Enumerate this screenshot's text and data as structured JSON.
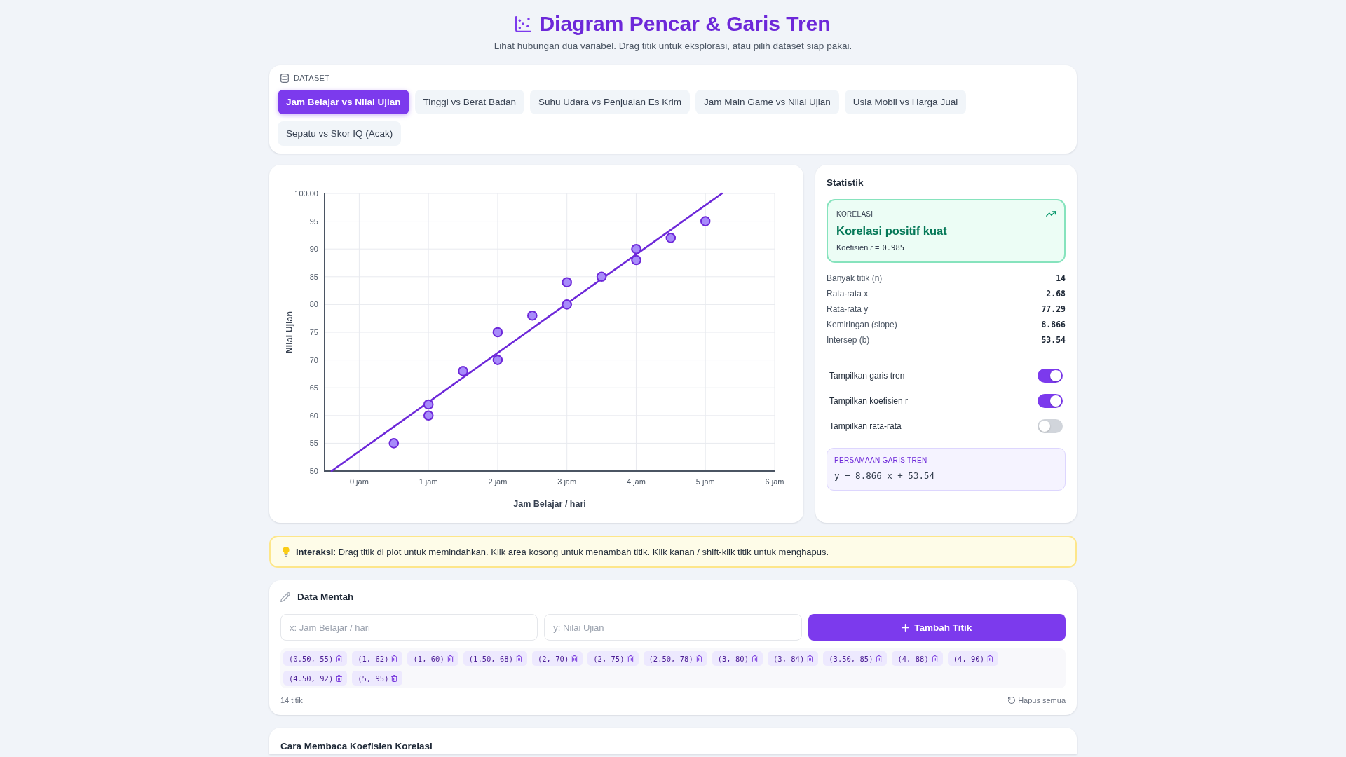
{
  "header": {
    "title": "Diagram Pencar & Garis Tren",
    "subtitle": "Lihat hubungan dua variabel. Drag titik untuk eksplorasi, atau pilih dataset siap pakai."
  },
  "dataset": {
    "label": "DATASET",
    "options": [
      {
        "label": "Jam Belajar vs Nilai Ujian",
        "selected": true
      },
      {
        "label": "Tinggi vs Berat Badan",
        "selected": false
      },
      {
        "label": "Suhu Udara vs Penjualan Es Krim",
        "selected": false
      },
      {
        "label": "Jam Main Game vs Nilai Ujian",
        "selected": false
      },
      {
        "label": "Usia Mobil vs Harga Jual",
        "selected": false
      },
      {
        "label": "Sepatu vs Skor IQ (Acak)",
        "selected": false
      }
    ]
  },
  "chart": {
    "chart_data": {
      "type": "scatter",
      "xlabel": "Jam Belajar / hari",
      "ylabel": "Nilai Ujian",
      "x": [
        0.5,
        1,
        1,
        1.5,
        2,
        2,
        2.5,
        3,
        3,
        3.5,
        4,
        4,
        4.5,
        5
      ],
      "series": [
        {
          "color": "#a78bfa",
          "values": [
            55,
            62,
            60,
            68,
            70,
            75,
            78,
            80,
            84,
            85,
            88,
            90,
            92,
            95
          ]
        },
        {
          "type": "line",
          "color": "#6d28d9",
          "x": [
            -0.4,
            5.24
          ],
          "values": [
            50,
            100
          ]
        }
      ],
      "xlim": [
        -0.5,
        6
      ],
      "ylim": [
        50,
        100
      ],
      "xticks": [
        {
          "value": 0,
          "label": "0 jam"
        },
        {
          "value": 1,
          "label": "1 jam"
        },
        {
          "value": 2,
          "label": "2 jam"
        },
        {
          "value": 3,
          "label": "3 jam"
        },
        {
          "value": 4,
          "label": "4 jam"
        },
        {
          "value": 5,
          "label": "5 jam"
        },
        {
          "value": 6,
          "label": "6 jam"
        }
      ],
      "yticks": [
        50,
        55,
        60,
        65,
        70,
        75,
        80,
        85,
        90,
        95,
        {
          "value": 100,
          "label": "100.00"
        }
      ],
      "grid": true
    }
  },
  "stats": {
    "title": "Statistik",
    "correlation": {
      "label": "KORELASI",
      "verdict": "Korelasi positif kuat",
      "coefficient_label": "Koefisien *r* =",
      "coefficient": "0.985"
    },
    "rows": [
      {
        "label": "Banyak titik (n)",
        "value": "14"
      },
      {
        "label": "Rata-rata x",
        "value": "2.68"
      },
      {
        "label": "Rata-rata y",
        "value": "77.29"
      },
      {
        "label": "Kemiringan (slope)",
        "value": "8.866"
      },
      {
        "label": "Intersep (b)",
        "value": "53.54"
      }
    ],
    "toggles": [
      {
        "label": "Tampilkan garis tren",
        "on": true
      },
      {
        "label": "Tampilkan koefisien r",
        "on": true
      },
      {
        "label": "Tampilkan rata-rata",
        "on": false
      }
    ],
    "equation": {
      "label": "PERSAMAAN GARIS TREN",
      "text": "y = 8.866 x + 53.54"
    }
  },
  "hint": {
    "text": "**Interaksi**: Drag titik di plot untuk memindahkan. Klik area kosong untuk menambah titik. Klik kanan / shift-klik titik untuk menghapus."
  },
  "raw_data": {
    "title": "Data Mentah",
    "x_field": {
      "placeholder": "x: Jam Belajar / hari"
    },
    "y_field": {
      "placeholder": "y: Nilai Ujian"
    },
    "add_button": "Tambah Titik",
    "points": [
      "(0.50, 55)",
      "(1, 62)",
      "(1, 60)",
      "(1.50, 68)",
      "(2, 70)",
      "(2, 75)",
      "(2.50, 78)",
      "(3, 80)",
      "(3, 84)",
      "(3.50, 85)",
      "(4, 88)",
      "(4, 90)",
      "(4.50, 92)",
      "(5, 95)"
    ],
    "count": "14 titik",
    "clear_button": "Hapus semua"
  },
  "guide": {
    "title": "Cara Membaca Koefisien Korelasi"
  }
}
